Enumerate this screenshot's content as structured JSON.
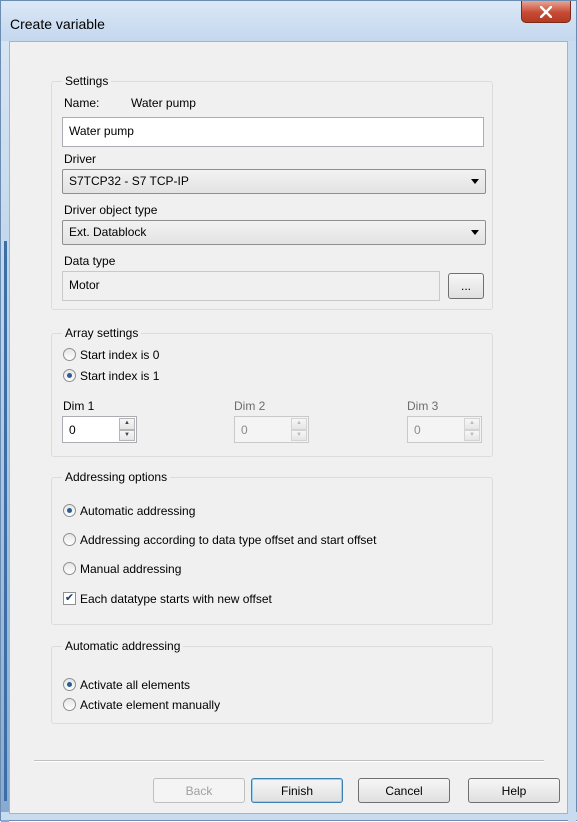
{
  "dialog": {
    "title": "Create variable"
  },
  "settings": {
    "legend": "Settings",
    "name_label": "Name:",
    "name_display": "Water pump",
    "name_value": "Water pump",
    "driver_label": "Driver",
    "driver_value": "S7TCP32 - S7 TCP-IP",
    "object_type_label": "Driver object type",
    "object_type_value": "Ext. Datablock",
    "data_type_label": "Data type",
    "data_type_value": "Motor",
    "browse_label": "..."
  },
  "array": {
    "legend": "Array settings",
    "start0_label": "Start index is 0",
    "start1_label": "Start index is 1",
    "start_index_selected": 1,
    "dim1_label": "Dim 1",
    "dim2_label": "Dim 2",
    "dim3_label": "Dim 3",
    "dim1_value": "0",
    "dim2_value": "0",
    "dim3_value": "0"
  },
  "addressing": {
    "legend": "Addressing options",
    "automatic_label": "Automatic addressing",
    "offset_label": "Addressing according to data type offset and start offset",
    "manual_label": "Manual addressing",
    "new_offset_label": "Each datatype starts with new offset",
    "new_offset_checked": true,
    "selected": "Automatic addressing"
  },
  "auto_addressing": {
    "legend": "Automatic addressing",
    "activate_all_label": "Activate all elements",
    "activate_manual_label": "Activate element manually",
    "selected": "Activate all elements"
  },
  "footer": {
    "back_label": "Back",
    "finish_label": "Finish",
    "cancel_label": "Cancel",
    "help_label": "Help"
  },
  "colors": {
    "frame": "#b9d1ea",
    "close_button": "#c74b34",
    "client_bg": "#f0f0f0"
  },
  "icons": {
    "close": "close-x-icon",
    "combo_arrow": "chevron-down-icon",
    "spin_up": "spin-up-icon",
    "spin_down": "spin-down-icon",
    "check": "checkmark-icon"
  }
}
